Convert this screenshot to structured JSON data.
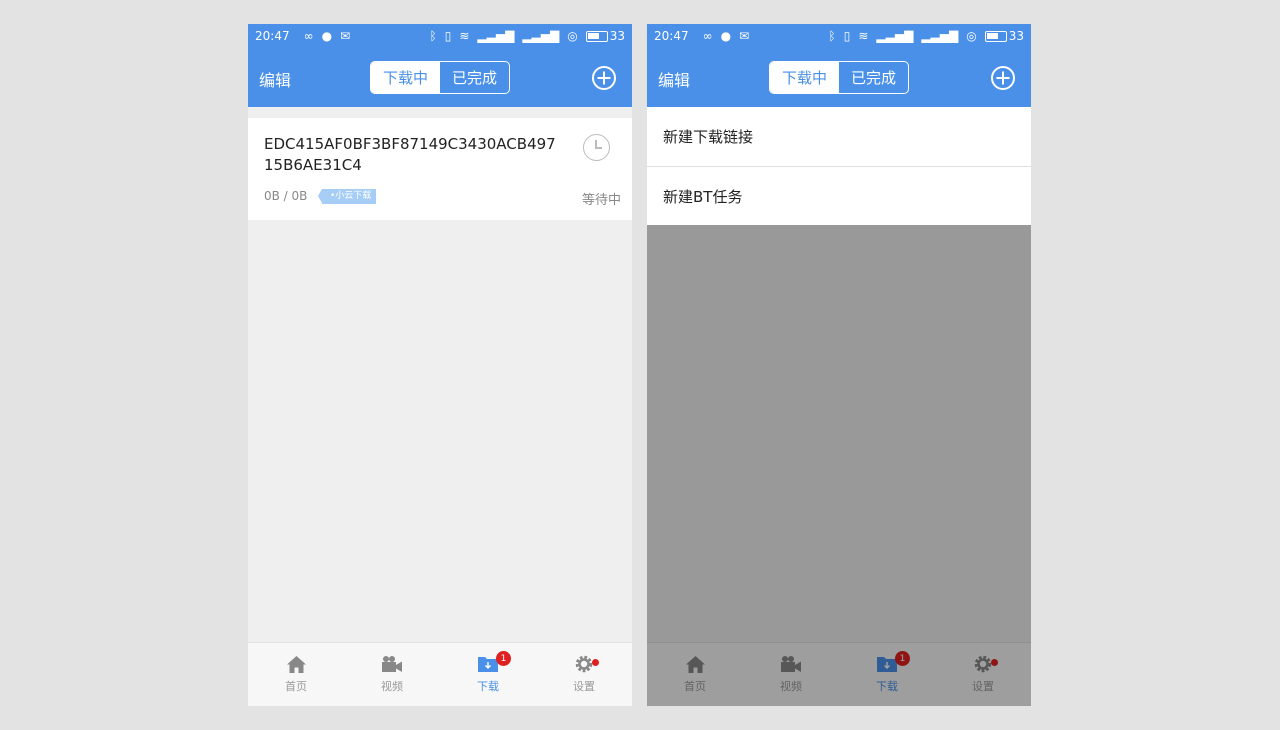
{
  "status_bar": {
    "time": "20:47",
    "battery_level": "33"
  },
  "app_bar": {
    "edit_label": "编辑",
    "tabs": [
      {
        "label": "下载中",
        "active": true
      },
      {
        "label": "已完成",
        "active": false
      }
    ]
  },
  "task": {
    "name": "EDC415AF0BF3BF87149C3430ACB49715B6AE31C4",
    "size": "0B / 0B",
    "tag": "•小云下载",
    "status": "等待中"
  },
  "add_menu": {
    "items": [
      "新建下载链接",
      "新建BT任务"
    ]
  },
  "tab_bar": {
    "items": [
      {
        "label": "首页",
        "icon": "home-icon"
      },
      {
        "label": "视频",
        "icon": "video-camera-icon"
      },
      {
        "label": "下载",
        "icon": "download-folder-icon",
        "badge": "1",
        "active": true
      },
      {
        "label": "设置",
        "icon": "gear-icon",
        "dot": true
      }
    ]
  },
  "colors": {
    "primary": "#4a90e8",
    "badge": "#e02020",
    "tag": "#a6cdf5"
  }
}
